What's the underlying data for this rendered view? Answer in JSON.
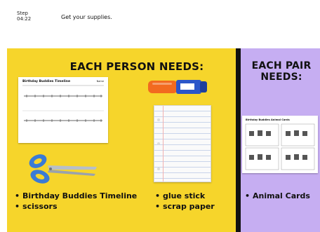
{
  "header": {
    "step_label": "Step",
    "timer": "04:22",
    "instruction": "Get your supplies."
  },
  "left_panel": {
    "heading": "EACH PERSON NEEDS:",
    "timeline_card": {
      "title": "Birthday Buddies Timeline",
      "tag": "Name"
    },
    "supplies": [
      "Birthday Buddies Timeline",
      "scissors"
    ],
    "supplies_mid": [
      "glue stick",
      "scrap paper"
    ]
  },
  "right_panel": {
    "heading_line1": "EACH PAIR",
    "heading_line2": "NEEDS:",
    "animal_card": {
      "title": "Birthday Buddies Animal Cards"
    },
    "supplies": [
      "Animal Cards"
    ]
  },
  "colors": {
    "yellow": "#f6d52b",
    "purple": "#c6aef2",
    "divider": "#111111",
    "glue_orange": "#f26a1f",
    "glue_blue": "#2b56c9",
    "scissor_blue": "#3a7bd5"
  },
  "icons": {
    "glue": "glue-stick-icon",
    "scissors": "scissors-icon",
    "paper": "lined-paper-icon"
  }
}
